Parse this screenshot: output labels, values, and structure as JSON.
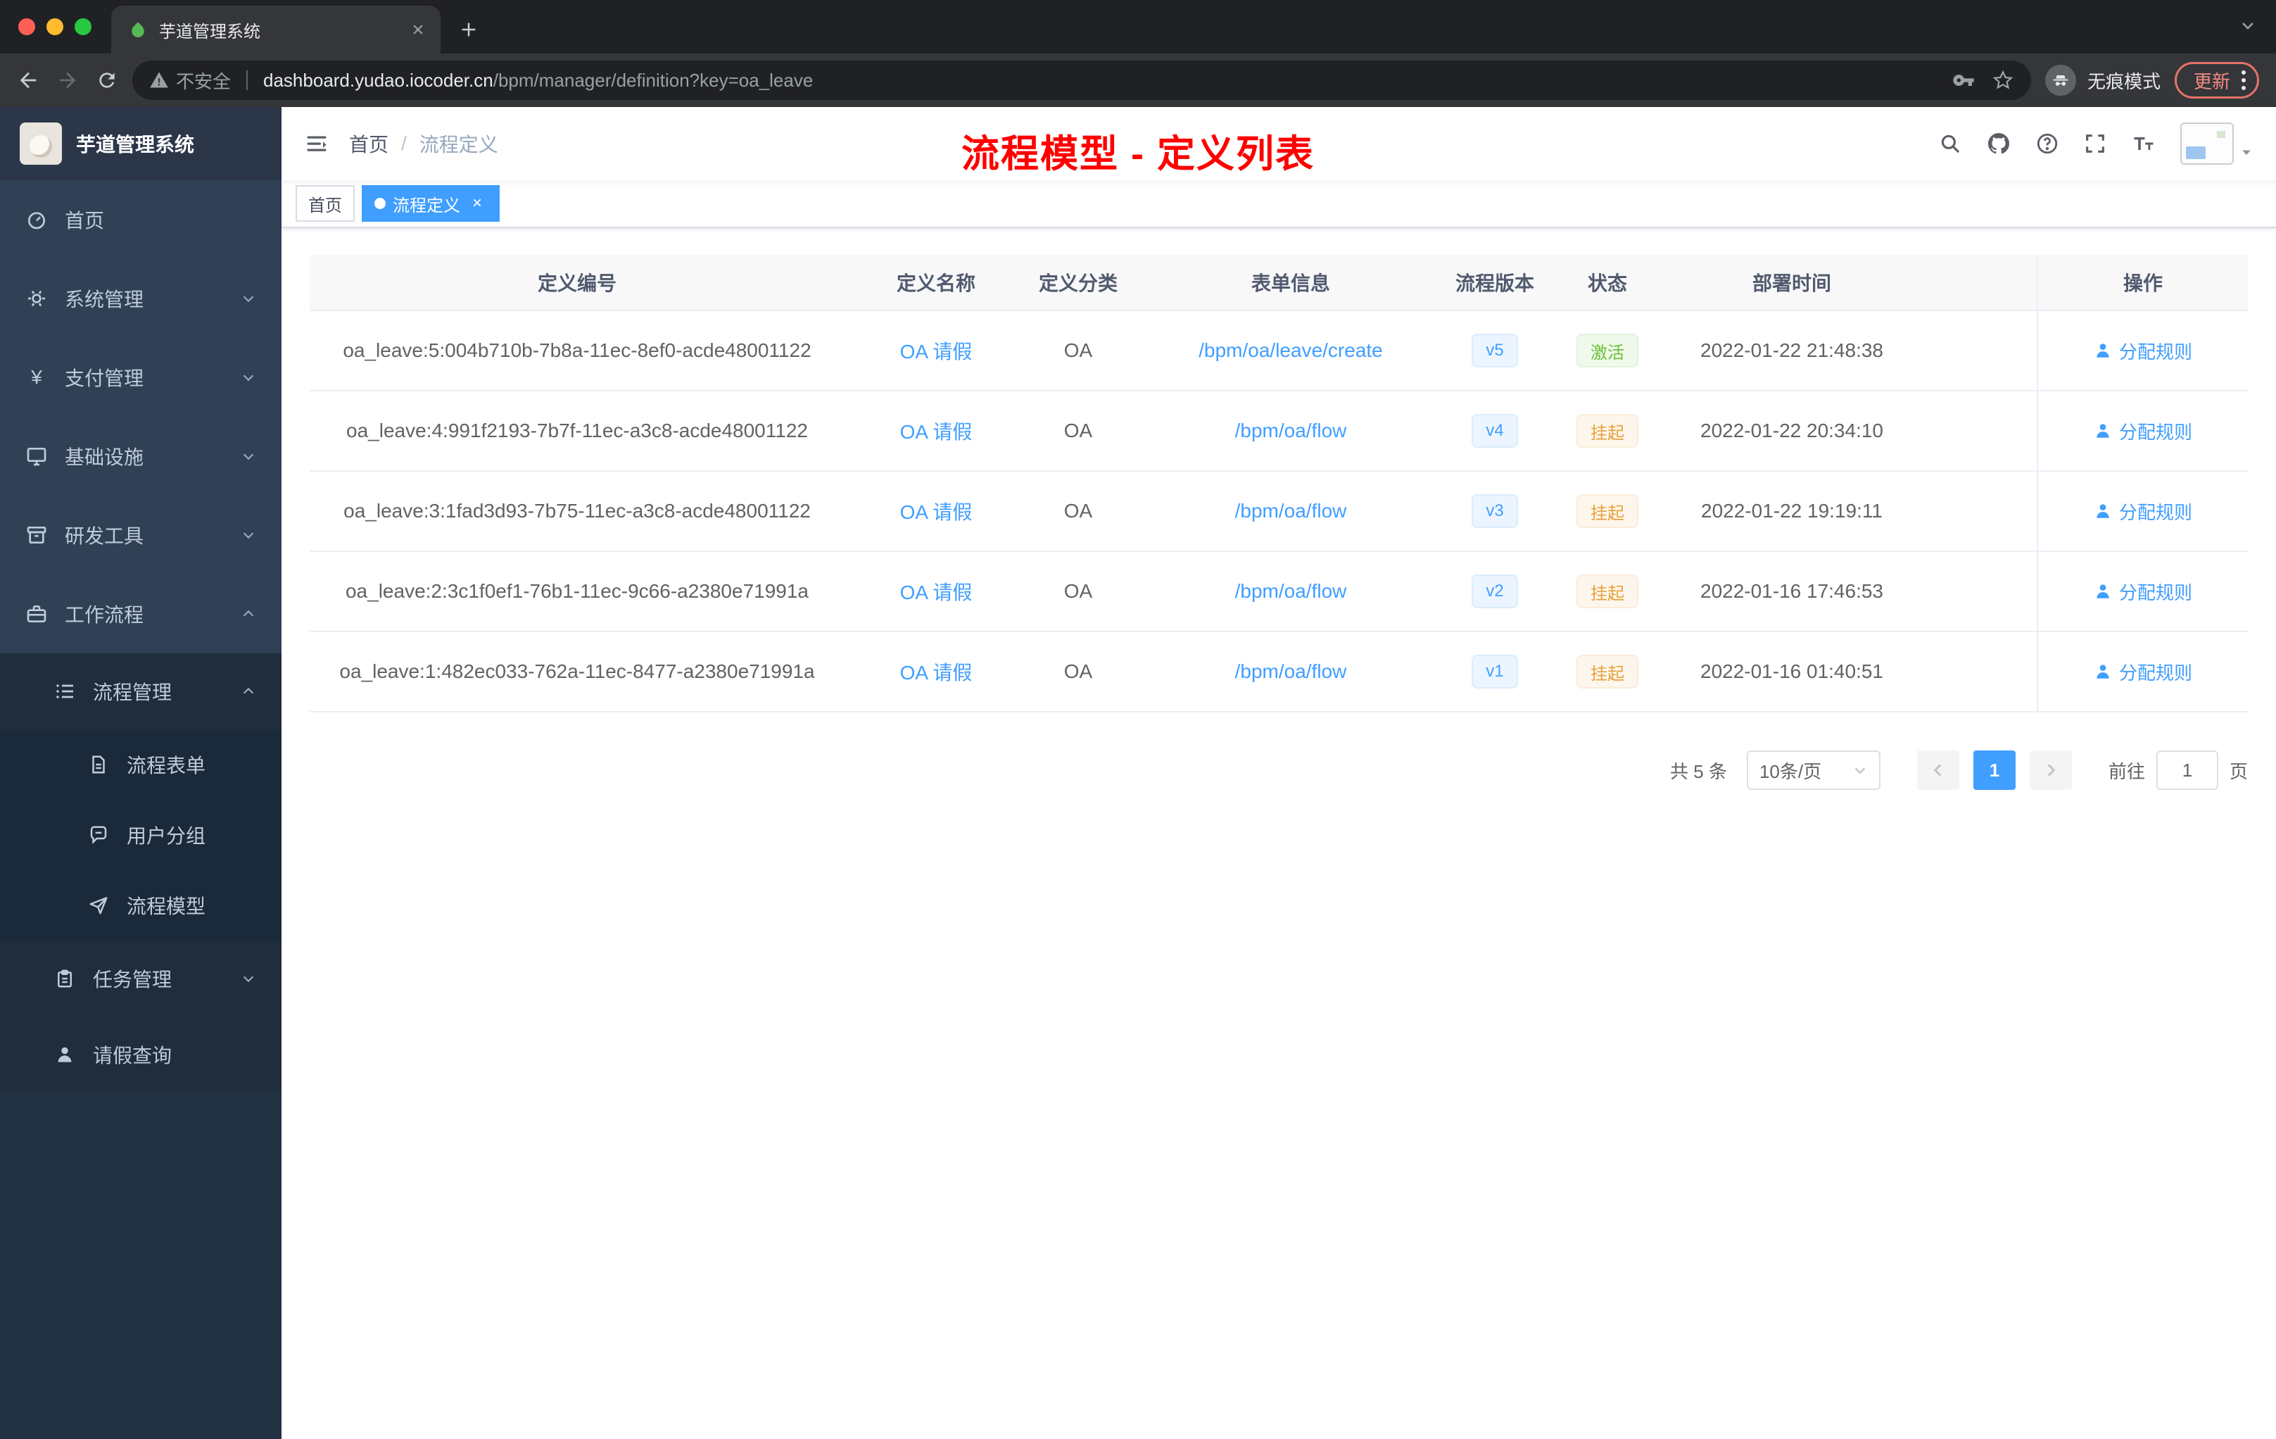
{
  "browser": {
    "tab_title": "芋道管理系统",
    "security_label": "不安全",
    "url_host": "dashboard.yudao.iocoder.cn",
    "url_path": "/bpm/manager/definition?key=oa_leave",
    "incognito_label": "无痕模式",
    "update_label": "更新"
  },
  "sidebar": {
    "logo_title": "芋道管理系统",
    "items": [
      {
        "label": "首页"
      },
      {
        "label": "系统管理"
      },
      {
        "label": "支付管理"
      },
      {
        "label": "基础设施"
      },
      {
        "label": "研发工具"
      },
      {
        "label": "工作流程"
      },
      {
        "label": "流程管理"
      },
      {
        "label": "流程表单"
      },
      {
        "label": "用户分组"
      },
      {
        "label": "流程模型"
      },
      {
        "label": "任务管理"
      },
      {
        "label": "请假查询"
      }
    ]
  },
  "header": {
    "breadcrumb": {
      "home": "首页",
      "separator": "/",
      "current": "流程定义"
    },
    "annotation": "流程模型 - 定义列表"
  },
  "tags_bar": {
    "tags": [
      {
        "label": "首页",
        "active": false
      },
      {
        "label": "流程定义",
        "active": true
      }
    ]
  },
  "table": {
    "columns": [
      "定义编号",
      "定义名称",
      "定义分类",
      "表单信息",
      "流程版本",
      "状态",
      "部署时间",
      "操作"
    ],
    "rows": [
      {
        "id": "oa_leave:5:004b710b-7b8a-11ec-8ef0-acde48001122",
        "name": "OA 请假",
        "category": "OA",
        "form": "/bpm/oa/leave/create",
        "version": "v5",
        "status": "激活",
        "status_type": "success",
        "deploy_time": "2022-01-22 21:48:38",
        "action": "分配规则"
      },
      {
        "id": "oa_leave:4:991f2193-7b7f-11ec-a3c8-acde48001122",
        "name": "OA 请假",
        "category": "OA",
        "form": "/bpm/oa/flow",
        "version": "v4",
        "status": "挂起",
        "status_type": "warning",
        "deploy_time": "2022-01-22 20:34:10",
        "action": "分配规则"
      },
      {
        "id": "oa_leave:3:1fad3d93-7b75-11ec-a3c8-acde48001122",
        "name": "OA 请假",
        "category": "OA",
        "form": "/bpm/oa/flow",
        "version": "v3",
        "status": "挂起",
        "status_type": "warning",
        "deploy_time": "2022-01-22 19:19:11",
        "action": "分配规则"
      },
      {
        "id": "oa_leave:2:3c1f0ef1-76b1-11ec-9c66-a2380e71991a",
        "name": "OA 请假",
        "category": "OA",
        "form": "/bpm/oa/flow",
        "version": "v2",
        "status": "挂起",
        "status_type": "warning",
        "deploy_time": "2022-01-16 17:46:53",
        "action": "分配规则"
      },
      {
        "id": "oa_leave:1:482ec033-762a-11ec-8477-a2380e71991a",
        "name": "OA 请假",
        "category": "OA",
        "form": "/bpm/oa/flow",
        "version": "v1",
        "status": "挂起",
        "status_type": "warning",
        "deploy_time": "2022-01-16 01:40:51",
        "action": "分配规则"
      }
    ]
  },
  "pagination": {
    "total": "共 5 条",
    "page_size": "10条/页",
    "current_page": "1",
    "goto_label": "前往",
    "goto_value": "1",
    "unit_label": "页"
  },
  "colors": {
    "primary": "#409eff",
    "success": "#67c23a",
    "warning": "#e6a23c",
    "annotation_red": "#fe0000",
    "sidebar_bg": "#304156",
    "submenu_bg": "#1f2d3d"
  }
}
